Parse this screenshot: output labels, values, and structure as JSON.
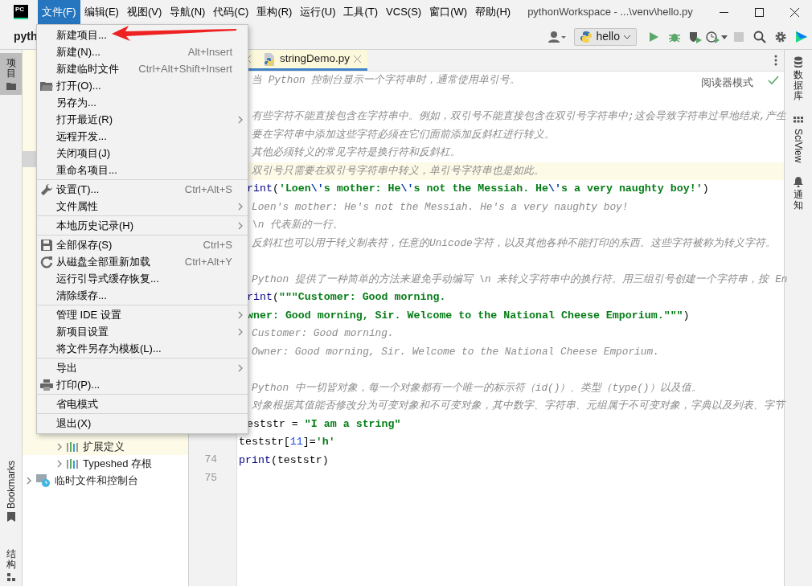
{
  "title_bar": {
    "logo": "PC",
    "title": "pythonWorkspace - ...\\venv\\hello.py",
    "menus": [
      {
        "label": "文件(F)",
        "selected": true
      },
      {
        "label": "编辑(E)",
        "selected": false
      },
      {
        "label": "视图(V)",
        "selected": false
      },
      {
        "label": "导航(N)",
        "selected": false
      },
      {
        "label": "代码(C)",
        "selected": false
      },
      {
        "label": "重构(R)",
        "selected": false
      },
      {
        "label": "运行(U)",
        "selected": false
      },
      {
        "label": "工具(T)",
        "selected": false
      },
      {
        "label": "VCS(S)",
        "selected": false
      },
      {
        "label": "窗口(W)",
        "selected": false
      },
      {
        "label": "帮助(H)",
        "selected": false
      }
    ]
  },
  "toolbar": {
    "project_name": "pyth",
    "run_config": "hello",
    "stop_disabled": true
  },
  "left_tool_windows": [
    {
      "label": "项目",
      "kind": "project",
      "selected": true
    },
    {
      "label": "Bookmarks",
      "kind": "bookmarks",
      "selected": false
    },
    {
      "label": "结构",
      "kind": "structure",
      "selected": false
    }
  ],
  "right_tool_windows": [
    {
      "label": "数据库",
      "kind": "database"
    },
    {
      "label": "SciView",
      "kind": "sciview"
    },
    {
      "label": "通知",
      "kind": "bell"
    }
  ],
  "project_tree": {
    "nested_items": [
      {
        "label": "扩展定义",
        "kind": "library",
        "expanded": false,
        "highlighted": true
      },
      {
        "label": "Typeshed 存根",
        "kind": "library",
        "expanded": false,
        "highlighted": false
      }
    ],
    "root_items": [
      {
        "label": "临时文件和控制台",
        "kind": "scratch",
        "expanded": false,
        "highlighted": false
      }
    ]
  },
  "editor": {
    "tabs": [
      {
        "label": "stringDemo.py",
        "selected": true
      }
    ],
    "reader_mode": "阅读器模式",
    "line_numbers": [
      "74",
      "75"
    ],
    "lines": [
      {
        "kind": "comment",
        "highlighted": false,
        "text": "当 Python 控制台显示一个字符串时，通常使用单引号。"
      },
      {
        "kind": "blank",
        "highlighted": false
      },
      {
        "kind": "comment",
        "highlighted": false,
        "text": "有些字符不能直接包含在字符串中。例如，双引号不能直接包含在双引号字符串中;这会导致字符串过早地结束,产生"
      },
      {
        "kind": "comment",
        "highlighted": false,
        "text": "要在字符串中添加这些字符必须在它们面前添加反斜杠进行转义。"
      },
      {
        "kind": "comment",
        "highlighted": false,
        "text": "其他必须转义的常见字符是换行符和反斜杠。"
      },
      {
        "kind": "comment",
        "highlighted": true,
        "text": "双引号只需要在双引号字符串中转义，单引号字符串也是如此。"
      },
      {
        "kind": "code_cut",
        "highlighted": false,
        "tokens": [
          {
            "t": "rint",
            "kind": "keyword"
          },
          {
            "t": "(",
            "kind": "plain"
          },
          {
            "t": "'Loen",
            "kind": "string"
          },
          {
            "t": "\\'",
            "kind": "escape"
          },
          {
            "t": "s mother: He",
            "kind": "string"
          },
          {
            "t": "\\'",
            "kind": "escape"
          },
          {
            "t": "s not the Messiah. He",
            "kind": "string"
          },
          {
            "t": "\\'",
            "kind": "escape"
          },
          {
            "t": "s a very naughty boy!'",
            "kind": "string"
          },
          {
            "t": ")",
            "kind": "plain"
          }
        ]
      },
      {
        "kind": "comment",
        "highlighted": false,
        "text": "Loen's mother: He's not the Messiah. He's a very naughty boy!"
      },
      {
        "kind": "comment",
        "highlighted": false,
        "text": "\\n 代表新的一行。"
      },
      {
        "kind": "comment",
        "highlighted": false,
        "text": "反斜杠也可以用于转义制表符，任意的Unicode字符，以及其他各种不能打印的东西。这些字符被称为转义字符。"
      },
      {
        "kind": "blank",
        "highlighted": false
      },
      {
        "kind": "comment",
        "highlighted": false,
        "text": "Python 提供了一种简单的方法来避免手动编写 \\n 来转义字符串中的换行符。用三组引号创建一个字符串，按 En"
      },
      {
        "kind": "code_cut",
        "highlighted": false,
        "tokens": [
          {
            "t": "rint",
            "kind": "keyword"
          },
          {
            "t": "(",
            "kind": "plain"
          },
          {
            "t": "\"\"\"Customer: Good morning.",
            "kind": "string"
          }
        ]
      },
      {
        "kind": "code_cut",
        "highlighted": false,
        "tokens": [
          {
            "t": "wner: Good morning, Sir. Welcome to the National Cheese Emporium.\"\"\"",
            "kind": "string"
          },
          {
            "t": ")",
            "kind": "plain"
          }
        ]
      },
      {
        "kind": "comment",
        "highlighted": false,
        "text": "Customer: Good morning."
      },
      {
        "kind": "comment",
        "highlighted": false,
        "text": "Owner: Good morning, Sir. Welcome to the National Cheese Emporium."
      },
      {
        "kind": "blank",
        "highlighted": false
      },
      {
        "kind": "comment",
        "highlighted": false,
        "text": "Python 中一切皆对象，每一个对象都有一个唯一的标示符（id()）、类型（type()）以及值。"
      },
      {
        "kind": "comment",
        "highlighted": false,
        "text": "对象根据其值能否修改分为可变对象和不可变对象，其中数字、字符串、元组属于不可变对象，字典以及列表、字节"
      },
      {
        "kind": "code_cut",
        "highlighted": false,
        "tokens": [
          {
            "t": "eststr = ",
            "kind": "plain"
          },
          {
            "t": "\"I am a string\"",
            "kind": "string"
          }
        ]
      },
      {
        "kind": "code",
        "highlighted": false,
        "tokens": [
          {
            "t": "teststr[",
            "kind": "plain"
          },
          {
            "t": "11",
            "kind": "number"
          },
          {
            "t": "]=",
            "kind": "plain"
          },
          {
            "t": "'h'",
            "kind": "string"
          }
        ]
      },
      {
        "kind": "code",
        "highlighted": false,
        "tokens": [
          {
            "t": "print",
            "kind": "keyword"
          },
          {
            "t": "(teststr)",
            "kind": "plain"
          }
        ]
      }
    ]
  },
  "file_menu": {
    "groups": [
      [
        {
          "label": "新建项目...",
          "kind": "plain",
          "has_submenu": false
        },
        {
          "label": "新建(N)...",
          "shortcut": "Alt+Insert",
          "kind": "plain",
          "has_submenu": false
        },
        {
          "label": "新建临时文件",
          "shortcut": "Ctrl+Alt+Shift+Insert",
          "kind": "plain",
          "has_submenu": false
        },
        {
          "label": "打开(O)...",
          "kind": "folder",
          "has_submenu": false
        },
        {
          "label": "另存为...",
          "kind": "plain",
          "has_submenu": false
        },
        {
          "label": "打开最近(R)",
          "kind": "plain",
          "has_submenu": true
        },
        {
          "label": "远程开发...",
          "kind": "plain",
          "has_submenu": false
        },
        {
          "label": "关闭项目(J)",
          "kind": "plain",
          "has_submenu": false
        },
        {
          "label": "重命名项目...",
          "kind": "plain",
          "has_submenu": false
        }
      ],
      [
        {
          "label": "设置(T)...",
          "shortcut": "Ctrl+Alt+S",
          "kind": "wrench",
          "has_submenu": false
        },
        {
          "label": "文件属性",
          "kind": "plain",
          "has_submenu": true
        }
      ],
      [
        {
          "label": "本地历史记录(H)",
          "kind": "plain",
          "has_submenu": true
        }
      ],
      [
        {
          "label": "全部保存(S)",
          "shortcut": "Ctrl+S",
          "kind": "save",
          "has_submenu": false
        },
        {
          "label": "从磁盘全部重新加载",
          "shortcut": "Ctrl+Alt+Y",
          "kind": "reload",
          "has_submenu": false
        },
        {
          "label": "运行引导式缓存恢复...",
          "kind": "plain",
          "has_submenu": false
        },
        {
          "label": "清除缓存...",
          "kind": "plain",
          "has_submenu": false
        }
      ],
      [
        {
          "label": "管理 IDE 设置",
          "kind": "plain",
          "has_submenu": true
        },
        {
          "label": "新项目设置",
          "kind": "plain",
          "has_submenu": true
        },
        {
          "label": "将文件另存为模板(L)...",
          "kind": "plain",
          "has_submenu": false
        }
      ],
      [
        {
          "label": "导出",
          "kind": "plain",
          "has_submenu": true
        },
        {
          "label": "打印(P)...",
          "kind": "print",
          "has_submenu": false
        }
      ],
      [
        {
          "label": "省电模式",
          "kind": "plain",
          "has_submenu": false
        }
      ],
      [
        {
          "label": "退出(X)",
          "kind": "plain",
          "has_submenu": false
        }
      ]
    ]
  }
}
